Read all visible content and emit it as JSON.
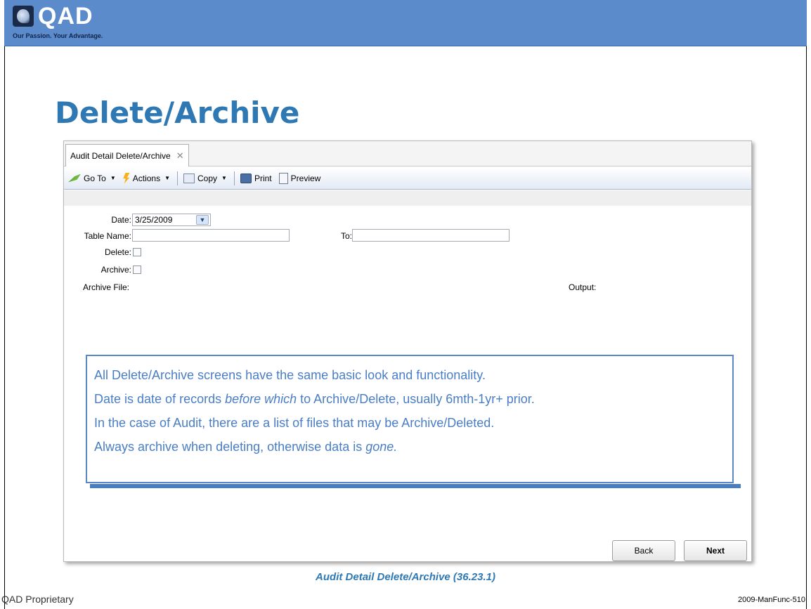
{
  "slide": {
    "title": "Delete/Archive",
    "caption": "Audit Detail Delete/Archive (36.23.1)",
    "footer_left": "QAD Proprietary",
    "footer_right": "2009-ManFunc-510"
  },
  "logo": {
    "name": "QAD",
    "tagline": "Our Passion. Your Advantage."
  },
  "app": {
    "tab_label": "Audit Detail Delete/Archive",
    "toolbar": {
      "goto": "Go To",
      "actions": "Actions",
      "copy": "Copy",
      "print": "Print",
      "preview": "Preview"
    },
    "form": {
      "date_label": "Date:",
      "date_value": "3/25/2009",
      "table_name_label": "Table Name:",
      "table_name_value": "",
      "to_label": "To:",
      "to_value": "",
      "delete_label": "Delete:",
      "delete_checked": false,
      "archive_label": "Archive:",
      "archive_checked": false,
      "archive_file_label": "Archive File:",
      "output_label": "Output:"
    },
    "buttons": {
      "back": "Back",
      "next": "Next"
    }
  },
  "callout": {
    "line1": "All Delete/Archive screens have the same basic look and functionality.",
    "line2_pre": "Date is date of records ",
    "line2_em": "before which",
    "line2_post": " to Archive/Delete, usually 6mth-1yr+ prior.",
    "line3": "In the case of Audit, there are a list of files that may be Archive/Deleted.",
    "line4_pre": "Always archive when deleting, otherwise data is ",
    "line4_em": "gone."
  },
  "colors": {
    "header": "#5b8bcb",
    "title": "#2e78b4",
    "callout_text": "#4a7ec4"
  }
}
